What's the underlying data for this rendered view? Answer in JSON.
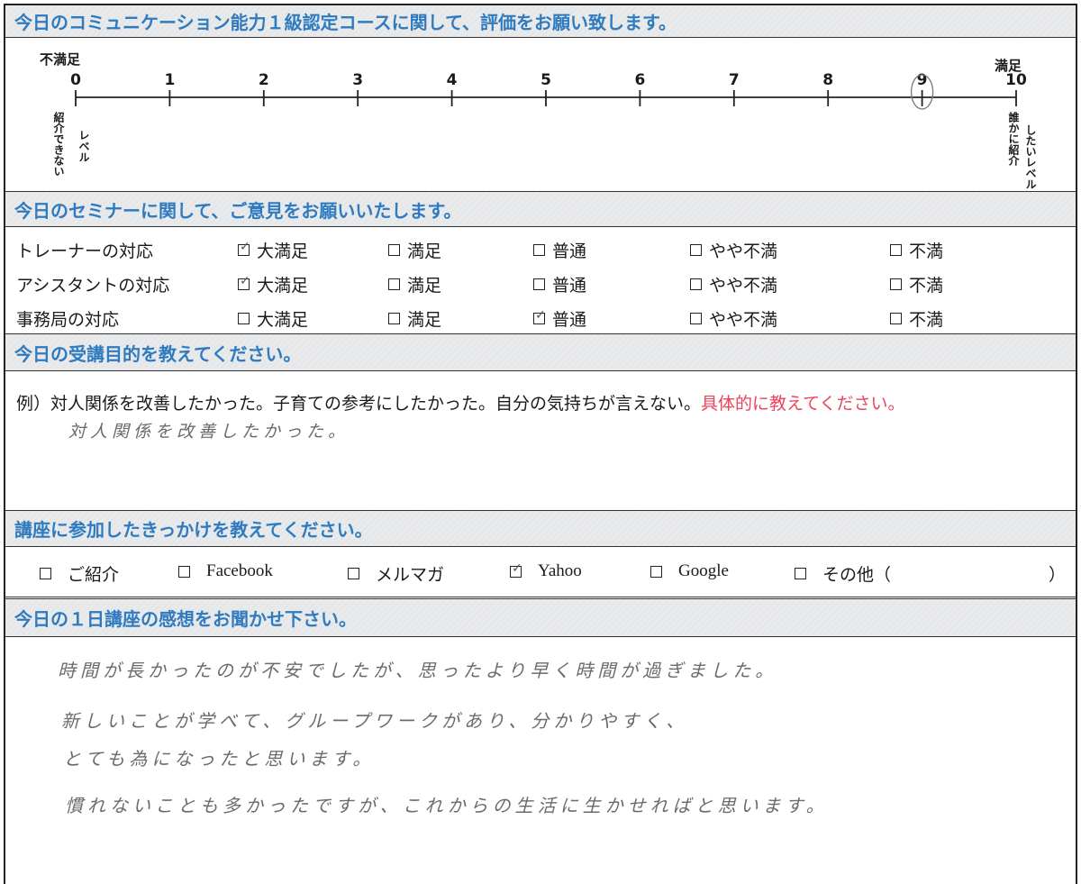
{
  "course_rating": {
    "header": "今日のコミュニケーション能力１級認定コースに関して、評価をお願い致します。",
    "left_label": "不満足",
    "right_label": "満足",
    "scale": [
      "0",
      "1",
      "2",
      "3",
      "4",
      "5",
      "6",
      "7",
      "8",
      "9",
      "10"
    ],
    "left_note_1": "紹介できない",
    "left_note_2": "レベル",
    "right_note_1": "誰かに紹介",
    "right_note_2": "したいレベル",
    "selected_value": 9
  },
  "seminar": {
    "header": "今日のセミナーに関して、ご意見をお願いいたします。",
    "options": [
      "大満足",
      "満足",
      "普通",
      "やや不満",
      "不満"
    ],
    "rows": [
      {
        "label": "トレーナーの対応",
        "checked": 0
      },
      {
        "label": "アシスタントの対応",
        "checked": 0
      },
      {
        "label": "事務局の対応",
        "checked": 2
      }
    ]
  },
  "purpose": {
    "header": "今日の受講目的を教えてください。",
    "example_text": "例）対人関係を改善したかった。子育ての参考にしたかった。自分の気持ちが言えない。",
    "example_emphasis": "具体的に教えてください。",
    "answer": "対人関係を改善したかった。"
  },
  "trigger": {
    "header": "講座に参加したきっかけを教えてください。",
    "options": [
      "ご紹介",
      "Facebook",
      "メルマガ",
      "Yahoo",
      "Google",
      "その他（"
    ],
    "close_paren": "）",
    "checked": 3
  },
  "impressions": {
    "header": "今日の１日講座の感想をお聞かせ下さい。",
    "lines": [
      "時間が長かったのが不安でしたが、思ったより早く時間が過ぎました。",
      "新しいことが学べて、グループワークがあり、分かりやすく、",
      "とても為になったと思います。",
      "慣れないことも多かったですが、これからの生活に生かせればと思います。"
    ]
  },
  "colors": {
    "header_text": "#2f7bbf",
    "emphasis": "#e8465b",
    "handwriting": "#6b6b6b"
  }
}
